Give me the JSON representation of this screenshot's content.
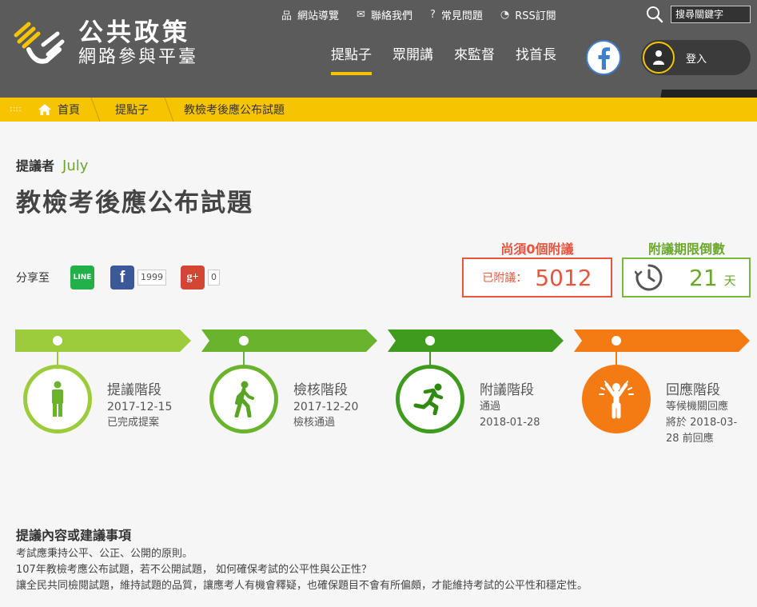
{
  "header": {
    "site_title_line1": "公共政策",
    "site_title_line2": "網路參與平臺",
    "top_links": [
      {
        "label": "網站導覽",
        "icon": "sitemap-icon",
        "glyph": "品"
      },
      {
        "label": "聯絡我們",
        "icon": "mail-icon",
        "glyph": "✉"
      },
      {
        "label": "常見問題",
        "icon": "question-icon",
        "glyph": "?"
      },
      {
        "label": "RSS訂閱",
        "icon": "rss-icon",
        "glyph": "◔"
      }
    ],
    "search_placeholder": "搜尋關鍵字",
    "nav": [
      {
        "label": "提點子",
        "active": true
      },
      {
        "label": "眾開講",
        "active": false
      },
      {
        "label": "來監督",
        "active": false
      },
      {
        "label": "找首長",
        "active": false
      }
    ],
    "login_label": "登入"
  },
  "breadcrumb": {
    "items": [
      "首頁",
      "提點子",
      "教檢考後應公布試題"
    ]
  },
  "proposal": {
    "proposer_label": "提議者",
    "proposer_name": "July",
    "title": "教檢考後應公布試題"
  },
  "share": {
    "label": "分享至",
    "line_label": "LINE",
    "facebook_count": "1999",
    "gplus_label": "g+",
    "gplus_count": "0"
  },
  "stats": {
    "need_label": "尚須0個附議",
    "seconded_label": "已附議：",
    "seconded_value": "5012",
    "countdown_label": "附議期限倒數",
    "countdown_value": "21",
    "countdown_unit": "天"
  },
  "stages": [
    {
      "name": "提議階段",
      "line1": "2017-12-15",
      "line2": "已完成提案",
      "color": "#9ccb3b",
      "icon": "standing-person-icon"
    },
    {
      "name": "檢核階段",
      "line1": "2017-12-20",
      "line2": "檢核通過",
      "color": "#6ab42d",
      "icon": "walking-person-icon"
    },
    {
      "name": "附議階段",
      "line1": "通過",
      "line2": "2018-01-28",
      "color": "#3f9b1e",
      "icon": "running-person-icon"
    },
    {
      "name": "回應階段",
      "line1": "等候機關回應",
      "line2": "將於  2018-03-",
      "line3": "28  前回應",
      "color": "#f47a14",
      "icon": "cheering-person-icon"
    }
  ],
  "content": {
    "section_title": "提議內容或建議事項",
    "paragraphs": [
      "考試應秉持公平、公正、公開的原則。",
      "107年教檢考應公布試題，若不公開試題， 如何確保考試的公平性與公正性？",
      "讓全民共同檢閱試題，維持試題的品質，讓應考人有機會釋疑，也確保題目不會有所偏頗，才能維持考試的公平性和穩定性。"
    ]
  }
}
